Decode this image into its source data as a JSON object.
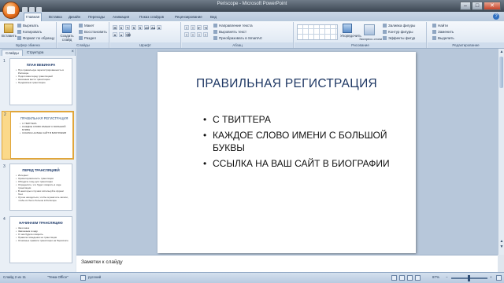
{
  "window": {
    "title": "Periscope - Microsoft PowerPoint"
  },
  "ribbon_tabs": [
    "Главная",
    "Вставка",
    "Дизайн",
    "Переходы",
    "Анимация",
    "Показ слайдов",
    "Рецензирование",
    "Вид"
  ],
  "ribbon": {
    "clipboard": {
      "paste": "Вставить",
      "cut": "Вырезать",
      "copy": "Копировать",
      "format_painter": "Формат по образцу",
      "label": "Буфер обмена"
    },
    "slides": {
      "new_slide": "Создать слайд",
      "layout": "Макет",
      "reset": "Восстановить",
      "section": "Раздел",
      "label": "Слайды"
    },
    "font": {
      "label": "Шрифт"
    },
    "paragraph": {
      "text_direction": "Направление текста",
      "align_text": "Выровнять текст",
      "smartart": "Преобразовать в SmartArt",
      "label": "Абзац"
    },
    "drawing": {
      "arrange": "Упорядочить",
      "quick_styles": "Экспресс-стили",
      "shape_fill": "Заливка фигуры",
      "shape_outline": "Контур фигуры",
      "shape_effects": "Эффекты фигур",
      "label": "Рисование"
    },
    "editing": {
      "find": "Найти",
      "replace": "Заменить",
      "select": "Выделить",
      "label": "Редактирование"
    }
  },
  "left_pane": {
    "tabs": [
      "Слайды",
      "Структура"
    ],
    "slides": [
      {
        "num": "1",
        "title": "ПЛАН ВЕБИНАРА",
        "items": [
          "Про правильную зарегистрированность в Periscope",
          "Подготовка перед трансляцией",
          "Начинаем вести трансляцию",
          "Продвигаем трансляцию"
        ]
      },
      {
        "num": "2",
        "title": "ПРАВИЛЬНАЯ РЕГИСТРАЦИЯ",
        "items": [
          "С ТВИТТЕРА",
          "КАЖДОЕ СЛОВО ИМЕНИ С БОЛЬШОЙ БУКВЫ",
          "ССЫЛКА НА ВАШ САЙТ В БИОГРАФИИ"
        ]
      },
      {
        "num": "3",
        "title": "ПЕРЕД ТРАНСЛЯЦИЕЙ",
        "items": [
          "Интернет",
          "Ориентировочность трансляции",
          "Обсудите тему для трансляции",
          "Определите, что будет говорить в ходе трансляции",
          "В некоторых случаях используйте Appear Tool.",
          "Лучше находиться, чтобы ограничить записи, чтобы их было больше в Periscope"
        ]
      },
      {
        "num": "4",
        "title": "НАЧИНАЕМ ТРАНСЛЯЦИЮ",
        "items": [
          "Заголовок",
          "Завлекаем в кадр",
          "О чем будете говорить",
          "Правила поведения на трансляции",
          "Основные правила трансляции на Перископе"
        ]
      }
    ]
  },
  "slide": {
    "title": "ПРАВИЛЬНАЯ РЕГИСТРАЦИЯ",
    "bullets": [
      "С ТВИТТЕРА",
      "КАЖДОЕ СЛОВО ИМЕНИ С БОЛЬШОЙ БУКВЫ",
      "ССЫЛКА НА ВАШ САЙТ В БИОГРАФИИ"
    ]
  },
  "notes": {
    "placeholder": "Заметки к слайду"
  },
  "status": {
    "slide_info": "Слайд 2 из 11",
    "theme": "\"Тема Office\"",
    "language": "русский",
    "zoom": "87%"
  }
}
